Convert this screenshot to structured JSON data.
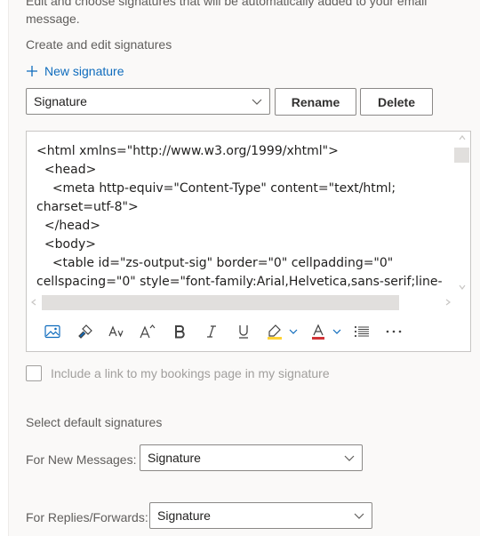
{
  "intro": {
    "text": "Edit and choose signatures that will be automatically added to your email message."
  },
  "create_section": {
    "title": "Create and edit signatures",
    "new_signature_label": "New signature",
    "signature_select_value": "Signature",
    "rename_label": "Rename",
    "delete_label": "Delete"
  },
  "editor": {
    "code_text": "<html xmlns=\"http://www.w3.org/1999/xhtml\">\n  <head>\n    <meta http-equiv=\"Content-Type\" content=\"text/html; charset=utf-8\">\n  </head>\n  <body>\n    <table id=\"zs-output-sig\" border=\"0\" cellpadding=\"0\" cellspacing=\"0\" style=\"font-family:Arial,Helvetica,sans-serif;line-",
    "toolbar_icons": [
      "insert-picture-icon",
      "format-painter-icon",
      "font-icon",
      "font-size-icon",
      "bold-icon",
      "italic-icon",
      "underline-icon",
      "highlight-icon",
      "font-color-icon",
      "bullets-icon",
      "more-options-icon"
    ],
    "highlight_color": "#ffd335",
    "font_color": "#d13438"
  },
  "bookings": {
    "label": "Include a link to my bookings page in my signature"
  },
  "defaults_section": {
    "title": "Select default signatures",
    "new_messages_label": "For New Messages:",
    "new_messages_value": "Signature",
    "replies_label": "For Replies/Forwards:",
    "replies_value": "Signature"
  },
  "colors": {
    "accent": "#0f6cbd",
    "border": "#8a8886",
    "muted_text": "#605e5c"
  }
}
